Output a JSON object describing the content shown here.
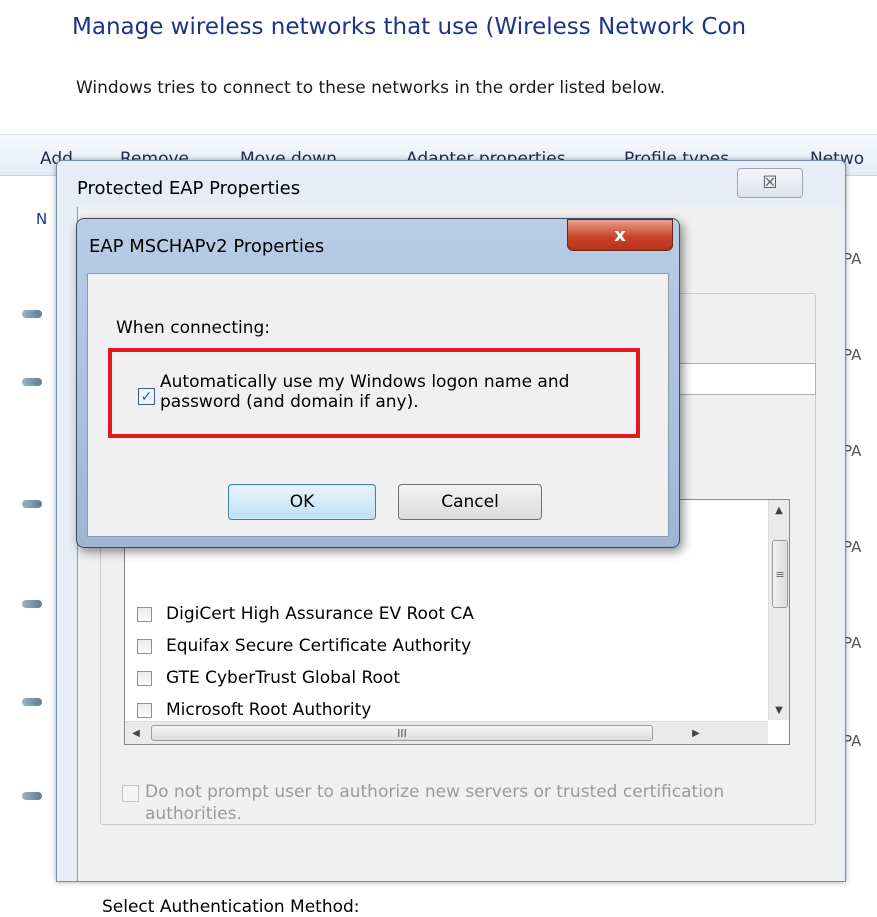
{
  "page": {
    "title": "Manage wireless networks that use (Wireless Network Con",
    "subtitle": "Windows tries to connect to these networks in the order listed below.",
    "toolbar": [
      "Add",
      "Remove",
      "Move down",
      "Adapter properties",
      "Profile types",
      "Netwo"
    ],
    "column_partial": "N",
    "row_suffix": "PA"
  },
  "peap": {
    "title": "Protected EAP Properties",
    "close_glyph": "☒",
    "certificates": [
      "DigiCert High Assurance EV Root CA",
      "Equifax Secure Certificate Authority",
      "GTE CyberTrust Global Root",
      "Microsoft Root Authority"
    ],
    "hscroll_grip": "III",
    "vscroll_grip": "≡",
    "prompt_label": "Do not prompt user to authorize new servers or trusted certification authorities.",
    "select_method_label": "Select Authentication Method:"
  },
  "mschap": {
    "title": "EAP MSCHAPv2 Properties",
    "close_glyph": "x",
    "when_connecting": "When connecting:",
    "auto_label": "Automatically use my Windows logon name and password (and domain if any).",
    "auto_checked": true,
    "check_glyph": "✓",
    "ok_label": "OK",
    "cancel_label": "Cancel"
  },
  "colors": {
    "title_blue": "#1e3287",
    "highlight_red": "#e01b24",
    "close_red": "#c9462a"
  }
}
